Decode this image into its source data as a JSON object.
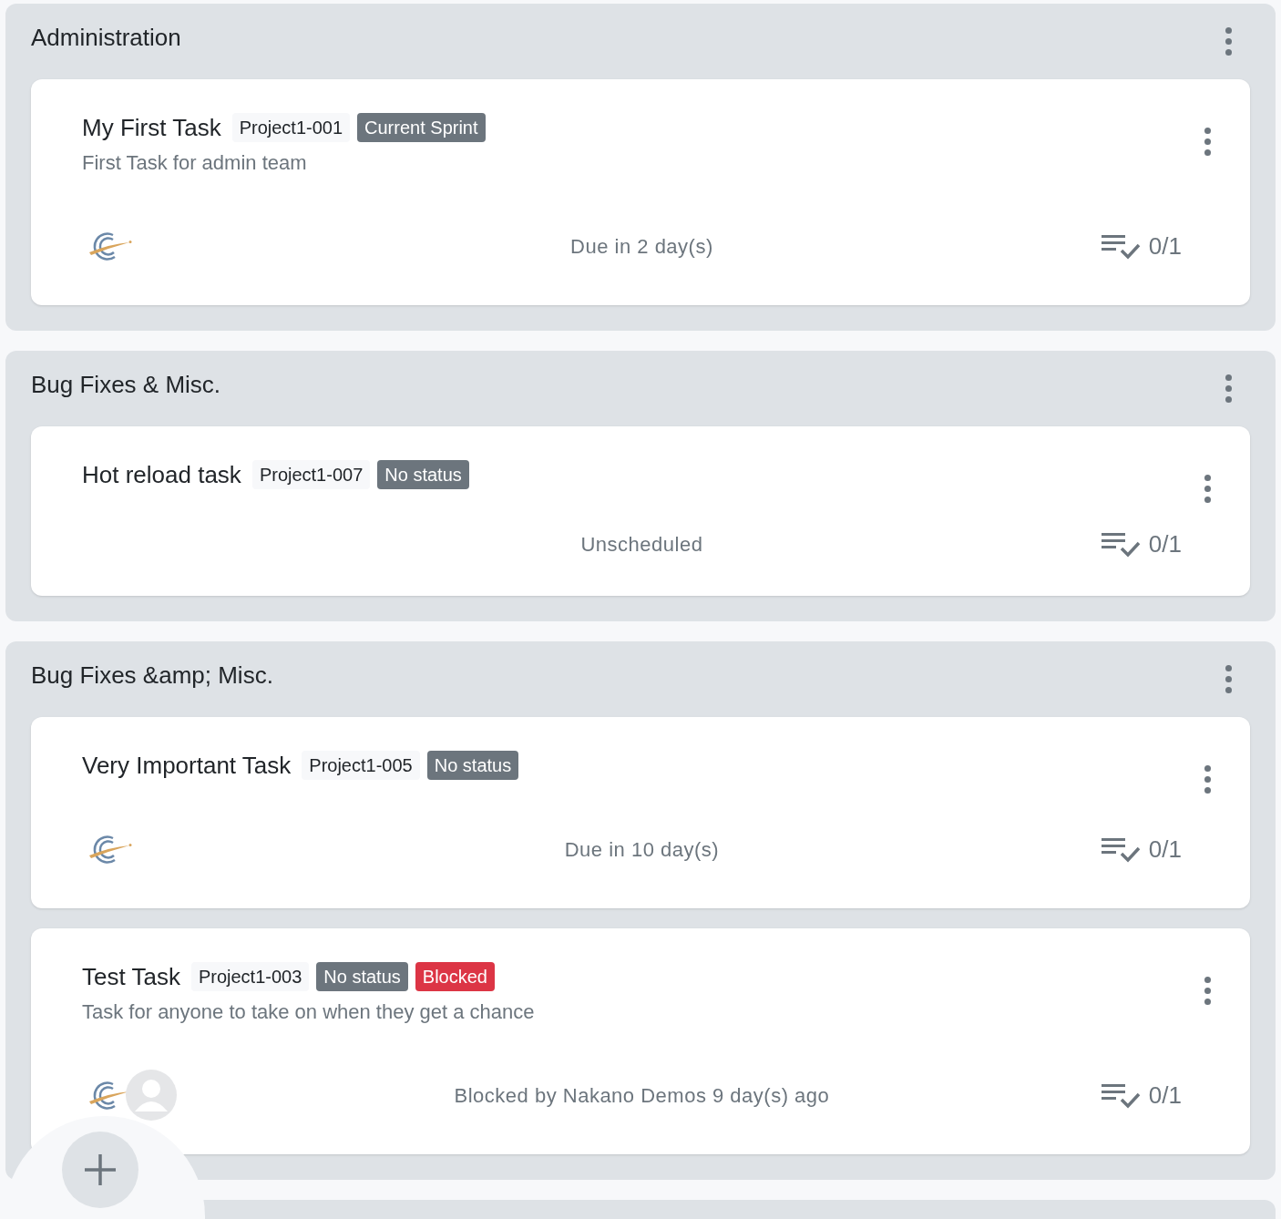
{
  "groups": [
    {
      "title": "Administration",
      "tasks": [
        {
          "title": "My First Task",
          "key": "Project1-001",
          "tags": [
            {
              "label": "Current Sprint",
              "color": "#6c757d"
            }
          ],
          "description": "First Task for admin team",
          "avatars": [
            {
              "kind": "logo"
            }
          ],
          "status_text": "Due in 2 day(s)",
          "checklist": "0/1"
        }
      ]
    },
    {
      "title": "Bug Fixes & Misc.",
      "tasks": [
        {
          "title": "Hot reload task",
          "key": "Project1-007",
          "tags": [
            {
              "label": "No status",
              "color": "#6c757d"
            }
          ],
          "status_text": "Unscheduled",
          "checklist": "0/1"
        }
      ]
    },
    {
      "title": "Bug Fixes &amp; Misc.",
      "tasks": [
        {
          "title": "Very Important Task",
          "key": "Project1-005",
          "tags": [
            {
              "label": "No status",
              "color": "#6c757d"
            }
          ],
          "avatars": [
            {
              "kind": "logo"
            }
          ],
          "status_text": "Due in 10 day(s)",
          "checklist": "0/1"
        },
        {
          "title": "Test Task",
          "key": "Project1-003",
          "tags": [
            {
              "label": "No status",
              "color": "#6c757d"
            },
            {
              "label": "Blocked",
              "color": "#dc3545"
            }
          ],
          "description": "Task for anyone to take on when they get a chance",
          "avatars": [
            {
              "kind": "logo"
            },
            {
              "kind": "person"
            }
          ],
          "status_text": "Blocked by Nakano Demos 9 day(s) ago",
          "checklist": "0/1"
        }
      ]
    }
  ]
}
